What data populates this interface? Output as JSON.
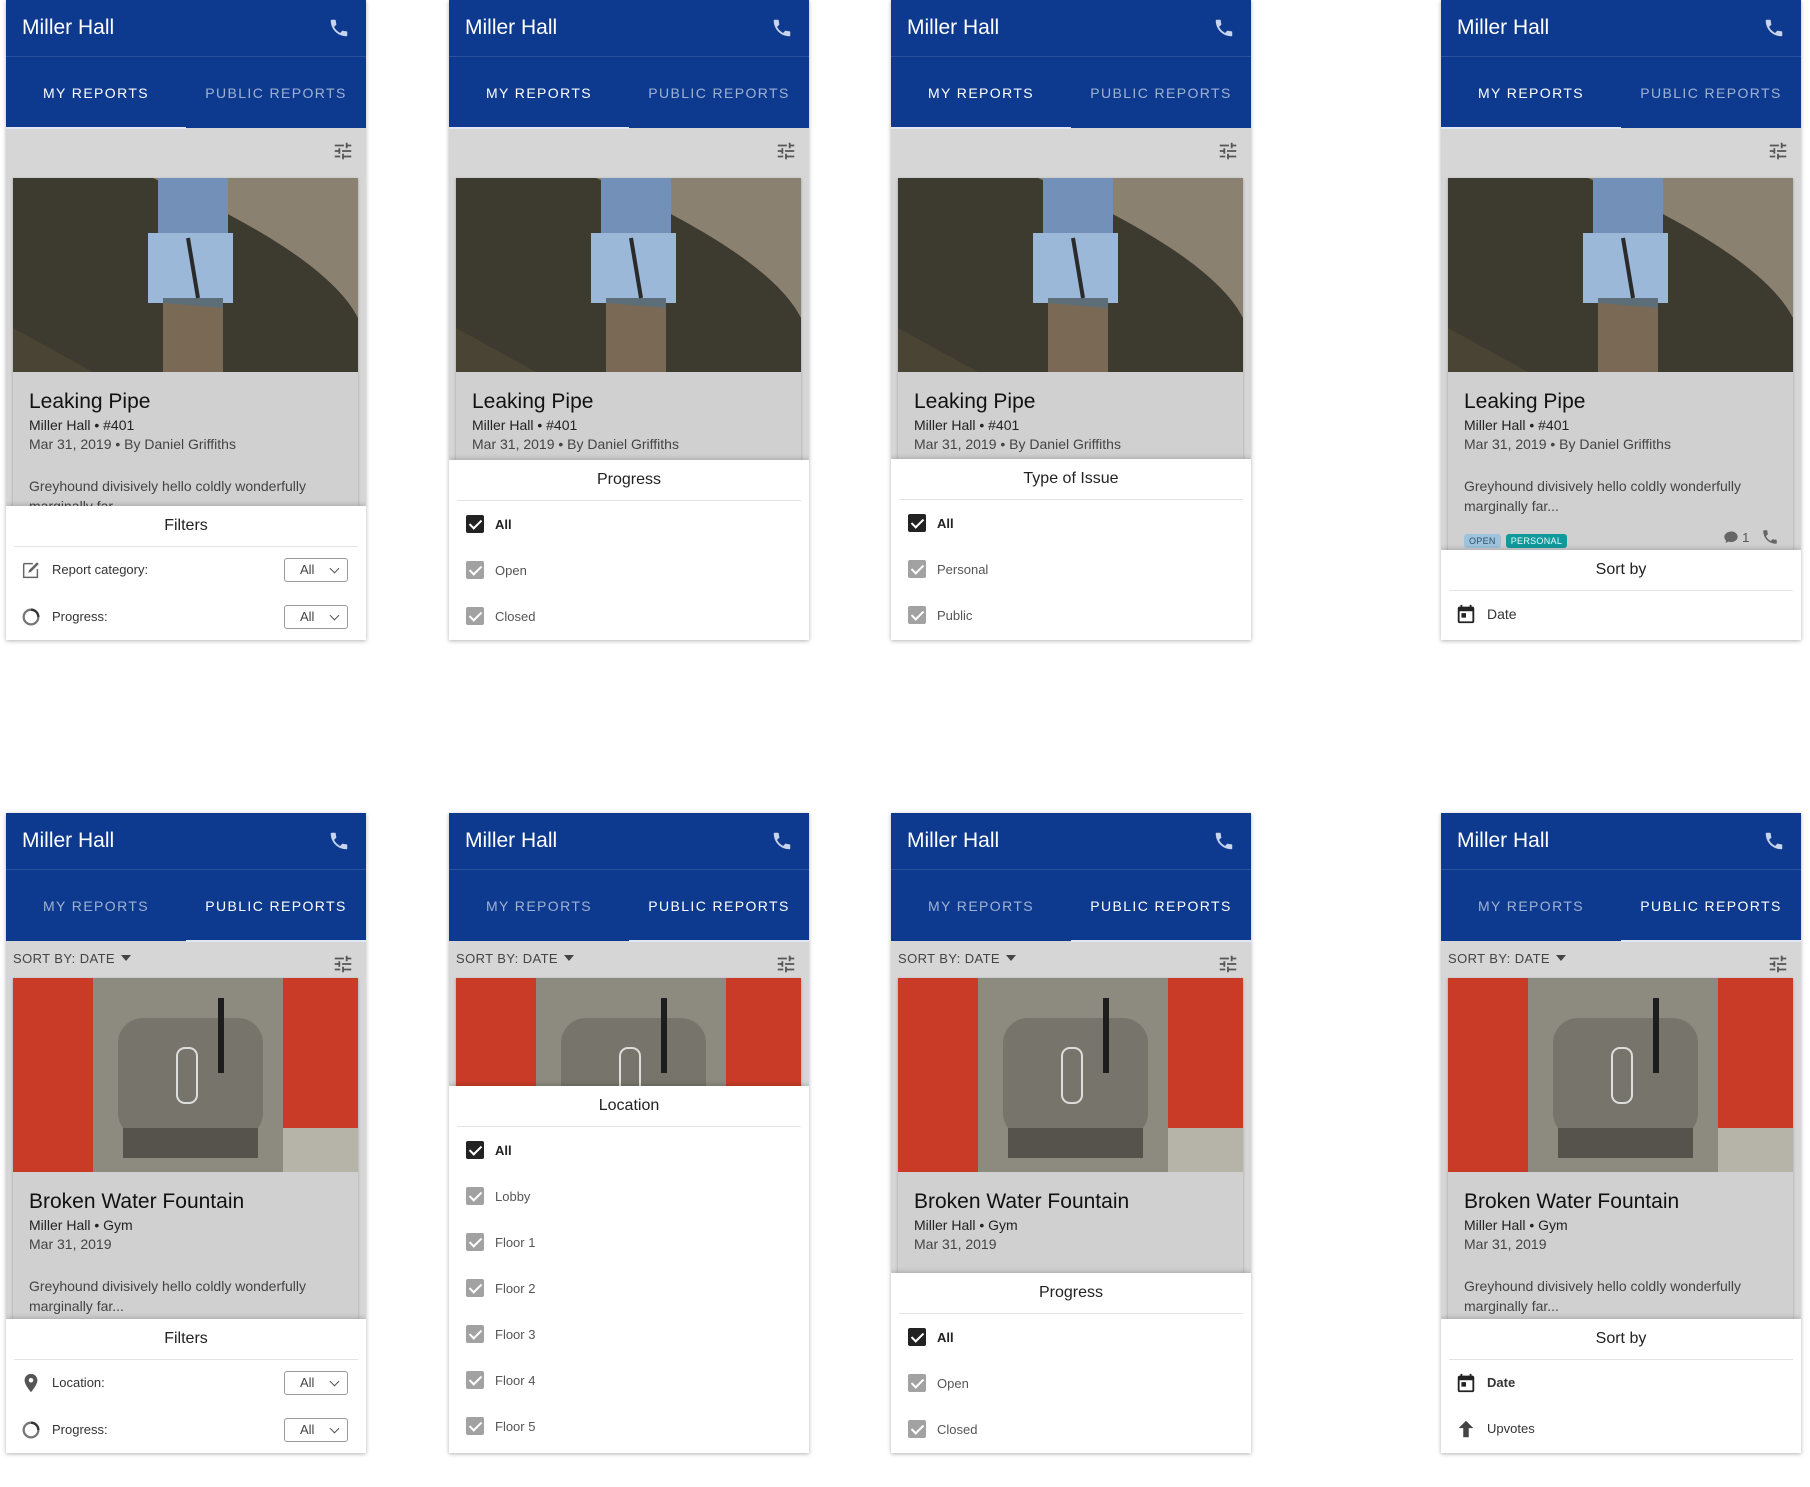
{
  "app": {
    "title": "Miller Hall",
    "tab_my": "MY REPORTS",
    "tab_public": "PUBLIC REPORTS",
    "sort_label": "SORT BY: DATE"
  },
  "icons": {
    "phone": "phone-icon",
    "tune": "tune-icon",
    "calendar": "calendar-icon",
    "upvote": "arrow-up-icon"
  },
  "colors": {
    "appbar": "#0d3a8e",
    "chip_open": "#9ec3dd",
    "chip_personal": "#11999c"
  },
  "report_pipe": {
    "title": "Leaking Pipe",
    "location": "Miller Hall • #401",
    "date": "Mar 31, 2019 • By Daniel Griffiths",
    "description": "Greyhound divisively hello coldly wonderfully marginally far...",
    "chip_open": "OPEN",
    "chip_personal": "PERSONAL",
    "comment_count": "1"
  },
  "report_fountain": {
    "title": "Broken Water Fountain",
    "location": "Miller Hall • Gym",
    "date": "Mar 31, 2019",
    "description": "Greyhound divisively hello coldly wonderfully marginally far..."
  },
  "filters": {
    "title": "Filters",
    "report_category_label": "Report category:",
    "location_label": "Location:",
    "progress_label": "Progress:",
    "value": "All"
  },
  "progress_sheet": {
    "title": "Progress",
    "options": [
      "All",
      "Open",
      "Closed"
    ]
  },
  "type_sheet": {
    "title": "Type of Issue",
    "options": [
      "All",
      "Personal",
      "Public"
    ]
  },
  "location_sheet": {
    "title": "Location",
    "options": [
      "All",
      "Lobby",
      "Floor 1",
      "Floor 2",
      "Floor 3",
      "Floor 4",
      "Floor 5"
    ]
  },
  "sort_sheet": {
    "title": "Sort by",
    "options": [
      "Date",
      "Upvotes"
    ]
  }
}
